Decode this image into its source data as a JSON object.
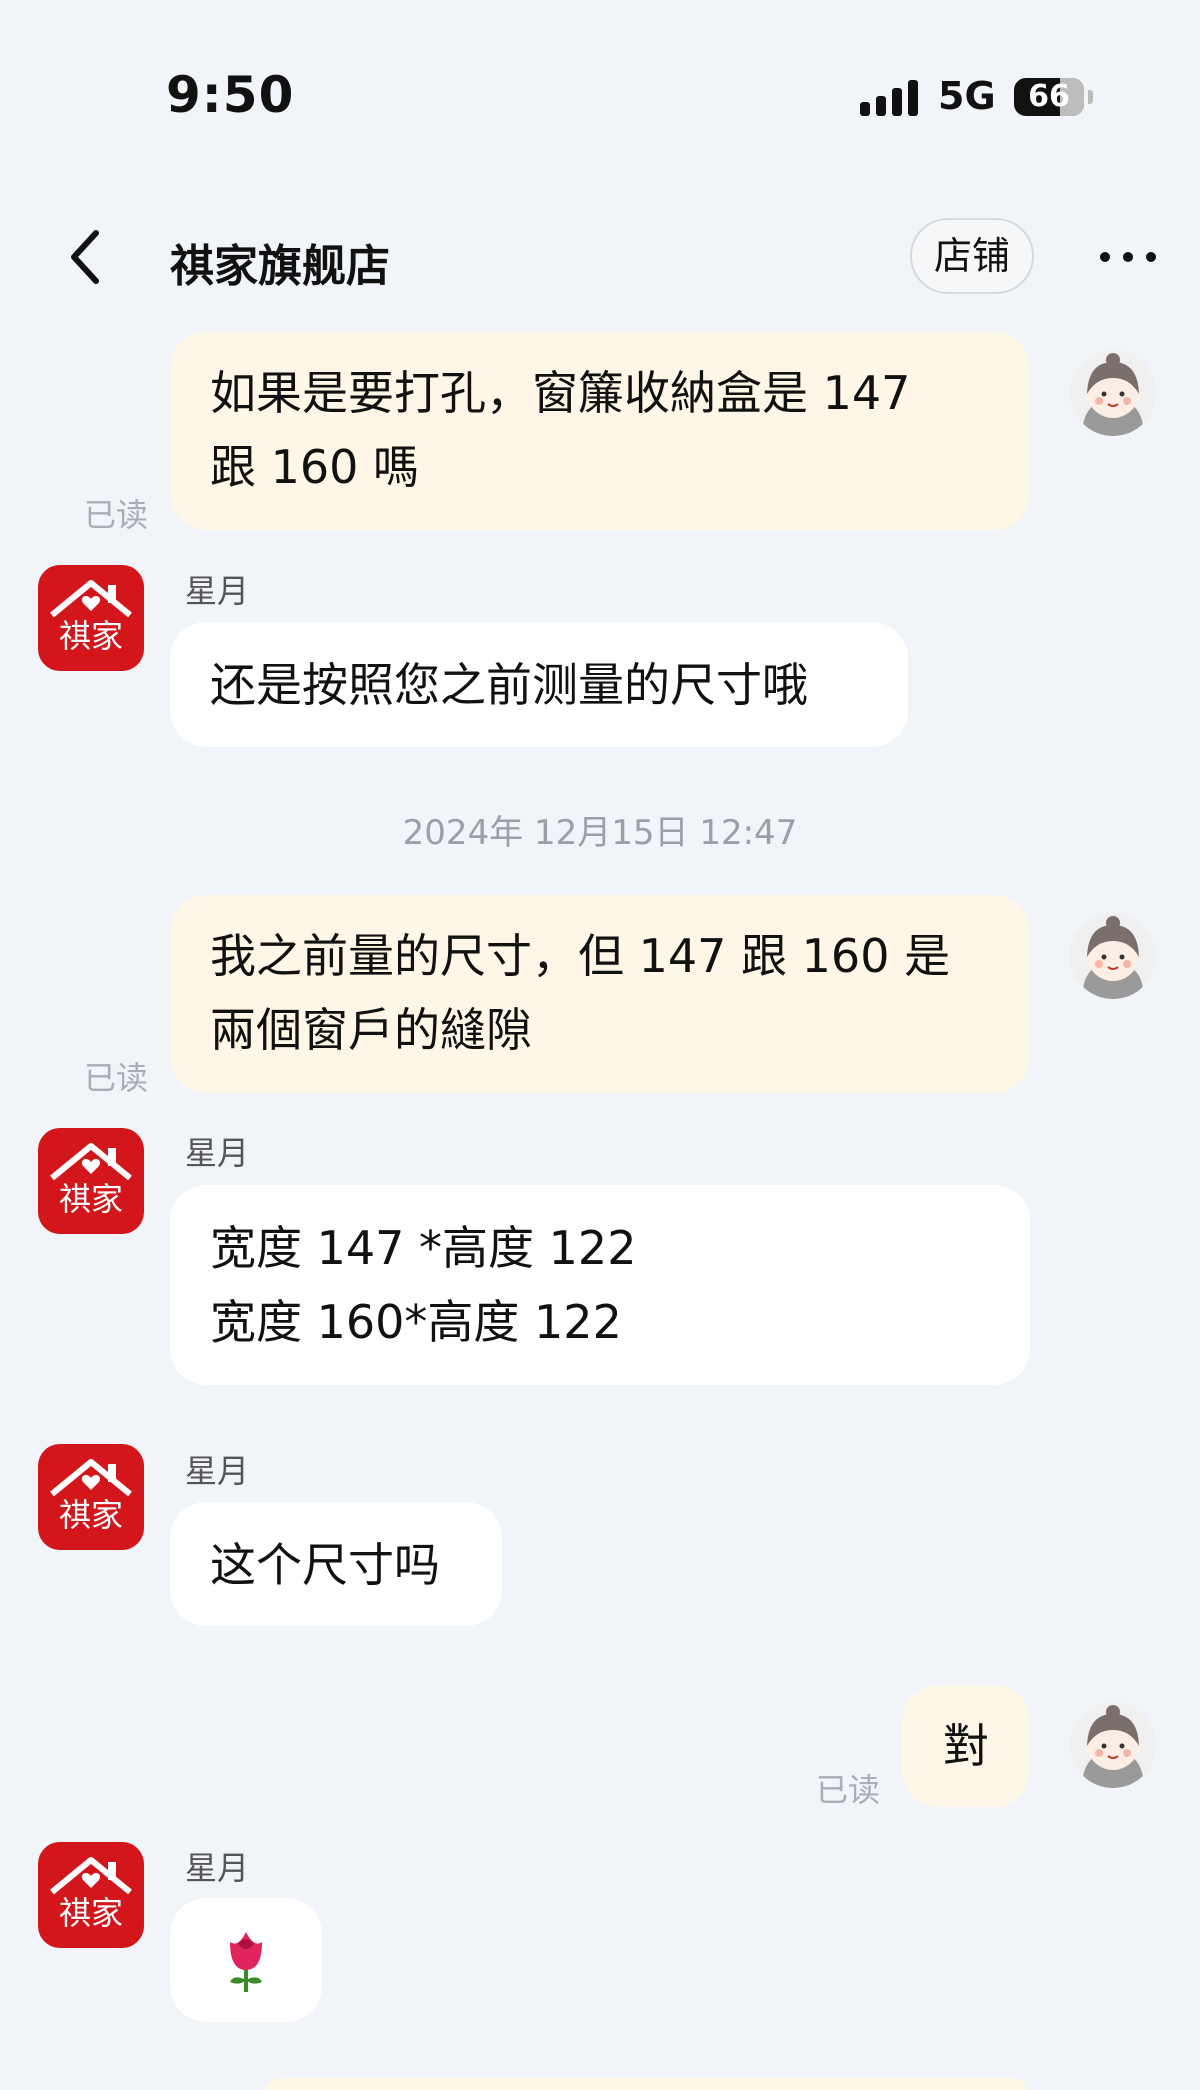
{
  "status_bar": {
    "time": "9:50",
    "network": "5G",
    "battery": "66"
  },
  "header": {
    "title": "祺家旗舰店",
    "store_button": "店铺"
  },
  "shop": {
    "logo_text": "祺家"
  },
  "messages": [
    {
      "side": "out",
      "lines": [
        "如果是要打孔，窗簾收納盒是 147",
        "跟 160 嗎"
      ],
      "read_label": "已读"
    },
    {
      "side": "in",
      "sender": "星月",
      "lines": [
        "还是按照您之前测量的尺寸哦"
      ]
    },
    {
      "side": "out",
      "lines": [
        "我之前量的尺寸，但 147 跟 160 是",
        "兩個窗戶的縫隙"
      ],
      "read_label": "已读"
    },
    {
      "side": "in",
      "sender": "星月",
      "lines": [
        "宽度 147 *高度 122",
        "宽度 160*高度 122"
      ]
    },
    {
      "side": "in",
      "sender": "星月",
      "lines": [
        "这个尺寸吗"
      ]
    },
    {
      "side": "out",
      "lines": [
        "對"
      ],
      "read_label": "已读"
    },
    {
      "side": "in",
      "sender": "星月",
      "emoji": "🌹"
    }
  ],
  "timestamp": "2024年 12月15日 12:47",
  "colors": {
    "background": "#f1f4f8",
    "outgoing_bubble": "#fef6e6",
    "incoming_bubble": "#ffffff",
    "shop_red": "#d2161b"
  }
}
